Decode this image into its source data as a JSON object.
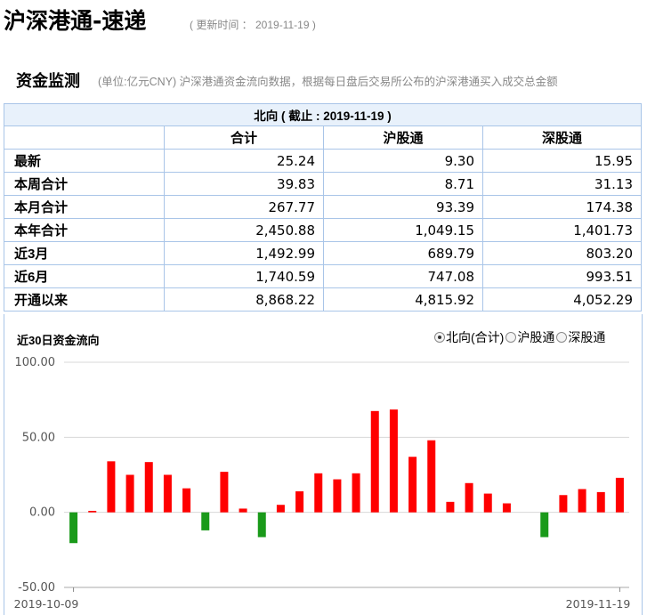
{
  "page": {
    "title": "沪深港通-速递",
    "update_time": "( 更新时间 ： 2019-11-19 )"
  },
  "section": {
    "title": "资金监测",
    "note": "(单位:亿元CNY)  沪深港通资金流向数据，根据每日盘后交易所公布的沪深港通买入成交总金额"
  },
  "table": {
    "caption": "北向 ( 截止 : 2019-11-19 )",
    "columns": [
      "",
      "合计",
      "沪股通",
      "深股通"
    ],
    "rows": [
      {
        "label": "最新",
        "cells": [
          "25.24",
          "9.30",
          "15.95"
        ]
      },
      {
        "label": "本周合计",
        "cells": [
          "39.83",
          "8.71",
          "31.13"
        ]
      },
      {
        "label": "本月合计",
        "cells": [
          "267.77",
          "93.39",
          "174.38"
        ]
      },
      {
        "label": "本年合计",
        "cells": [
          "2,450.88",
          "1,049.15",
          "1,401.73"
        ]
      },
      {
        "label": "近3月",
        "cells": [
          "1,492.99",
          "689.79",
          "803.20"
        ]
      },
      {
        "label": "近6月",
        "cells": [
          "1,740.59",
          "747.08",
          "993.51"
        ]
      },
      {
        "label": "开通以来",
        "cells": [
          "8,868.22",
          "4,815.92",
          "4,052.29"
        ]
      }
    ]
  },
  "chart_section": {
    "title": "近30日资金流向",
    "options": [
      {
        "label": "北向(合计)",
        "checked": true
      },
      {
        "label": "沪股通",
        "checked": false
      },
      {
        "label": "深股通",
        "checked": false
      }
    ]
  },
  "chart_data": {
    "type": "bar",
    "title": "近30日资金流向",
    "xlabel": "",
    "ylabel": "",
    "ylim": [
      -50,
      100
    ],
    "y_ticks": [
      "100.00",
      "50.00",
      "0.00",
      "-50.00"
    ],
    "x_tick_labels": [
      "2019-10-09",
      "2019-11-19"
    ],
    "values": [
      -20.5,
      1.0,
      34.0,
      25.0,
      33.5,
      25.0,
      16.0,
      -12.0,
      27.0,
      2.5,
      -16.5,
      5.0,
      14.0,
      26.0,
      22.0,
      26.0,
      67.5,
      68.5,
      37.0,
      48.0,
      7.0,
      19.5,
      12.5,
      6.0,
      0,
      -16.5,
      11.5,
      15.5,
      13.5,
      23.0
    ],
    "colors": {
      "positive": "#ff0000",
      "negative": "#1a9a1a"
    },
    "grid": true
  }
}
